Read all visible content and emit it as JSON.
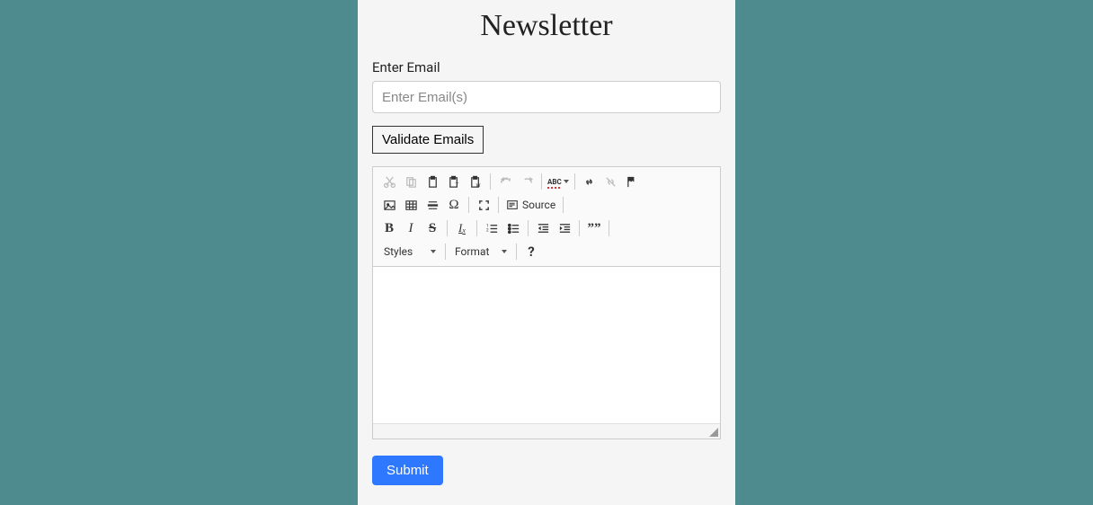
{
  "title": "Newsletter",
  "email": {
    "label": "Enter Email",
    "placeholder": "Enter Email(s)"
  },
  "buttons": {
    "validate": "Validate Emails",
    "submit": "Submit"
  },
  "toolbar": {
    "spellcheck": "ABC",
    "source": "Source",
    "styles": "Styles",
    "format": "Format",
    "help": "?",
    "bold": "B",
    "italic": "I",
    "strike": "S",
    "removeformat": "I",
    "removeformat_sub": "x",
    "quote": "””"
  }
}
